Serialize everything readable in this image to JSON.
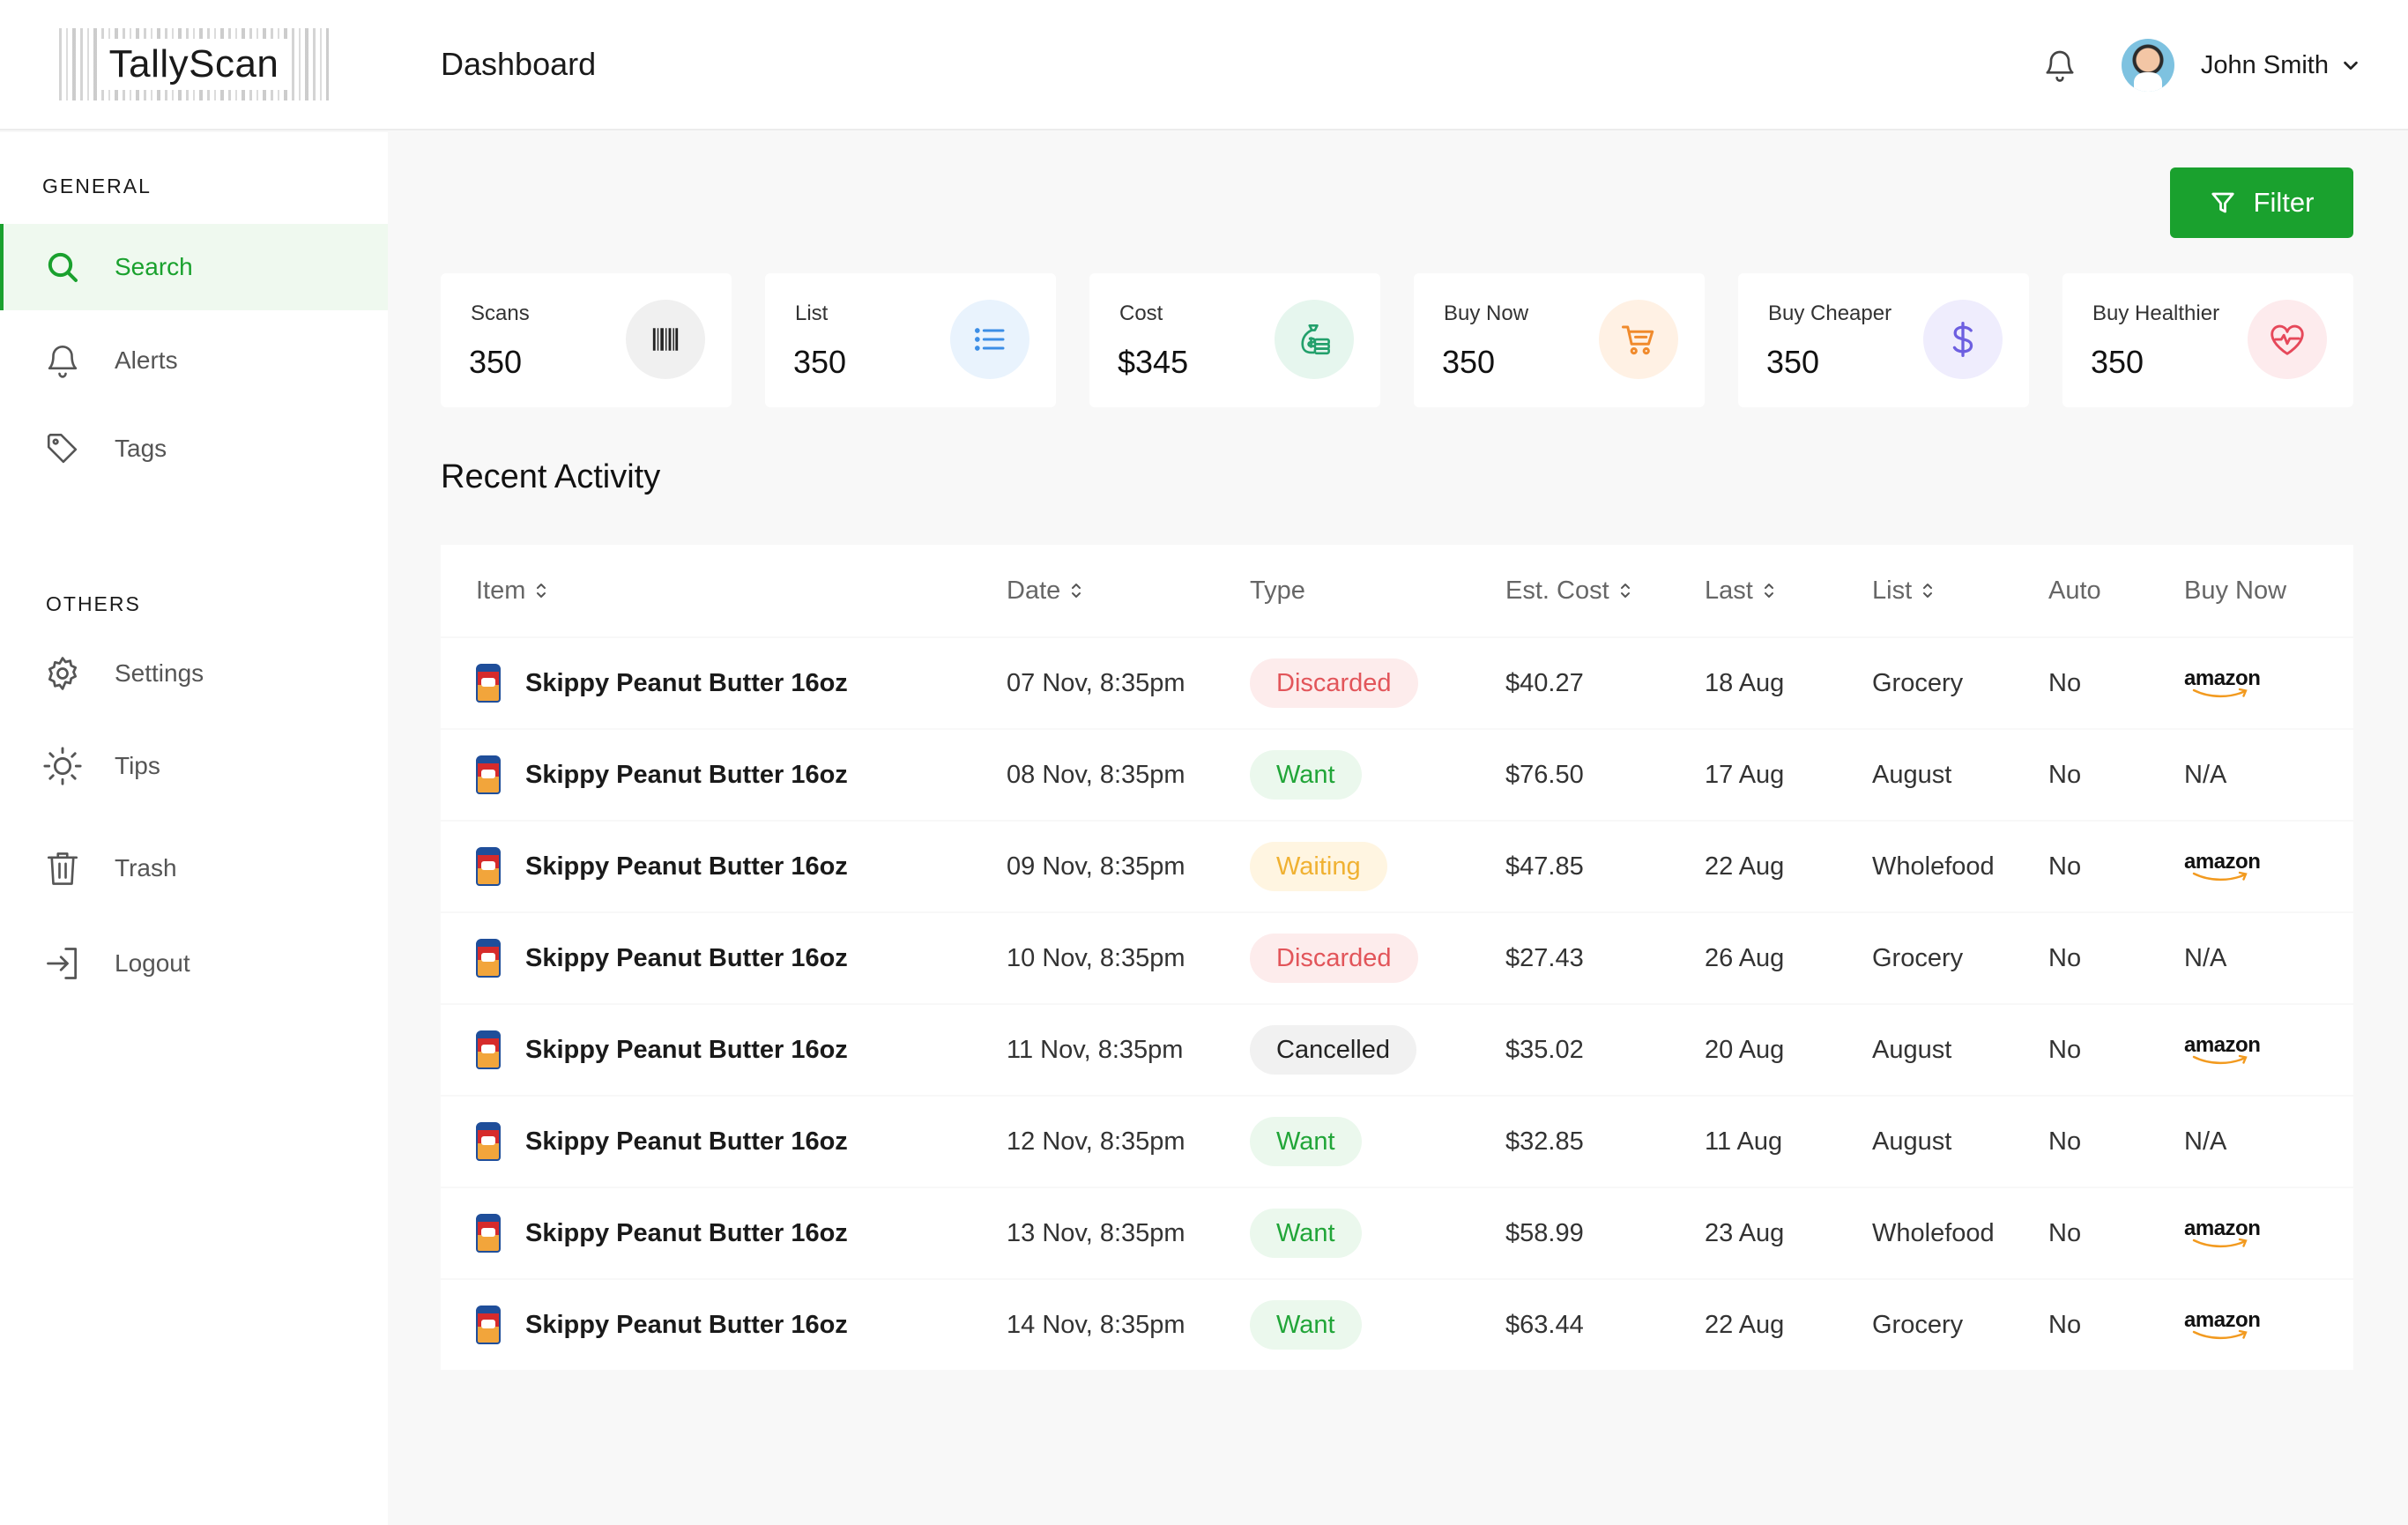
{
  "app": {
    "logo": "TallyScan",
    "page_title": "Dashboard"
  },
  "user": {
    "name": "John Smith"
  },
  "sidebar": {
    "general_label": "GENERAL",
    "others_label": "OTHERS",
    "general_items": [
      {
        "label": "Search",
        "icon": "search-icon",
        "active": true
      },
      {
        "label": "Alerts",
        "icon": "bell-icon"
      },
      {
        "label": "Tags",
        "icon": "tag-icon"
      }
    ],
    "other_items": [
      {
        "label": "Settings",
        "icon": "gear-icon"
      },
      {
        "label": "Tips",
        "icon": "sun-icon"
      },
      {
        "label": "Trash",
        "icon": "trash-icon"
      },
      {
        "label": "Logout",
        "icon": "logout-icon"
      }
    ]
  },
  "toolbar": {
    "filter_label": "Filter"
  },
  "stats": [
    {
      "label": "Scans",
      "value": "350",
      "icon": "barcode-icon",
      "color": "#2b2b2b",
      "bg": "#f0f0f0"
    },
    {
      "label": "List",
      "value": "350",
      "icon": "list-icon",
      "color": "#3c8ee6",
      "bg": "#e9f3fd"
    },
    {
      "label": "Cost",
      "value": "$345",
      "icon": "money-bag-icon",
      "color": "#22a06b",
      "bg": "#e6f6ee"
    },
    {
      "label": "Buy Now",
      "value": "350",
      "icon": "cart-icon",
      "color": "#f08a2c",
      "bg": "#fff1e4"
    },
    {
      "label": "Buy Cheaper",
      "value": "350",
      "icon": "dollar-icon",
      "color": "#6d5fe0",
      "bg": "#efedfd"
    },
    {
      "label": "Buy Healthier",
      "value": "350",
      "icon": "heart-pulse-icon",
      "color": "#e6485a",
      "bg": "#fdebed"
    }
  ],
  "recent_activity": {
    "title": "Recent Activity",
    "columns": [
      "Item",
      "Date",
      "Type",
      "Est. Cost",
      "Last",
      "List",
      "Auto",
      "Buy Now"
    ],
    "rows": [
      {
        "item": "Skippy Peanut Butter 16oz",
        "date": "07 Nov, 8:35pm",
        "type": "Discarded",
        "cost": "$40.27",
        "last": "18 Aug",
        "list": "Grocery",
        "auto": "No",
        "buy_now": "amazon"
      },
      {
        "item": "Skippy Peanut Butter 16oz",
        "date": "08 Nov, 8:35pm",
        "type": "Want",
        "cost": "$76.50",
        "last": "17 Aug",
        "list": "August",
        "auto": "No",
        "buy_now": "N/A"
      },
      {
        "item": "Skippy Peanut Butter 16oz",
        "date": "09 Nov, 8:35pm",
        "type": "Waiting",
        "cost": "$47.85",
        "last": "22 Aug",
        "list": "Wholefood",
        "auto": "No",
        "buy_now": "amazon"
      },
      {
        "item": "Skippy Peanut Butter 16oz",
        "date": "10 Nov, 8:35pm",
        "type": "Discarded",
        "cost": "$27.43",
        "last": "26 Aug",
        "list": "Grocery",
        "auto": "No",
        "buy_now": "N/A"
      },
      {
        "item": "Skippy Peanut Butter 16oz",
        "date": "11 Nov, 8:35pm",
        "type": "Cancelled",
        "cost": "$35.02",
        "last": "20 Aug",
        "list": "August",
        "auto": "No",
        "buy_now": "amazon"
      },
      {
        "item": "Skippy Peanut Butter 16oz",
        "date": "12 Nov, 8:35pm",
        "type": "Want",
        "cost": "$32.85",
        "last": "11 Aug",
        "list": "August",
        "auto": "No",
        "buy_now": "N/A"
      },
      {
        "item": "Skippy Peanut Butter 16oz",
        "date": "13 Nov, 8:35pm",
        "type": "Want",
        "cost": "$58.99",
        "last": "23 Aug",
        "list": "Wholefood",
        "auto": "No",
        "buy_now": "amazon"
      },
      {
        "item": "Skippy Peanut Butter 16oz",
        "date": "14 Nov, 8:35pm",
        "type": "Want",
        "cost": "$63.44",
        "last": "22 Aug",
        "list": "Grocery",
        "auto": "No",
        "buy_now": "amazon"
      }
    ]
  }
}
